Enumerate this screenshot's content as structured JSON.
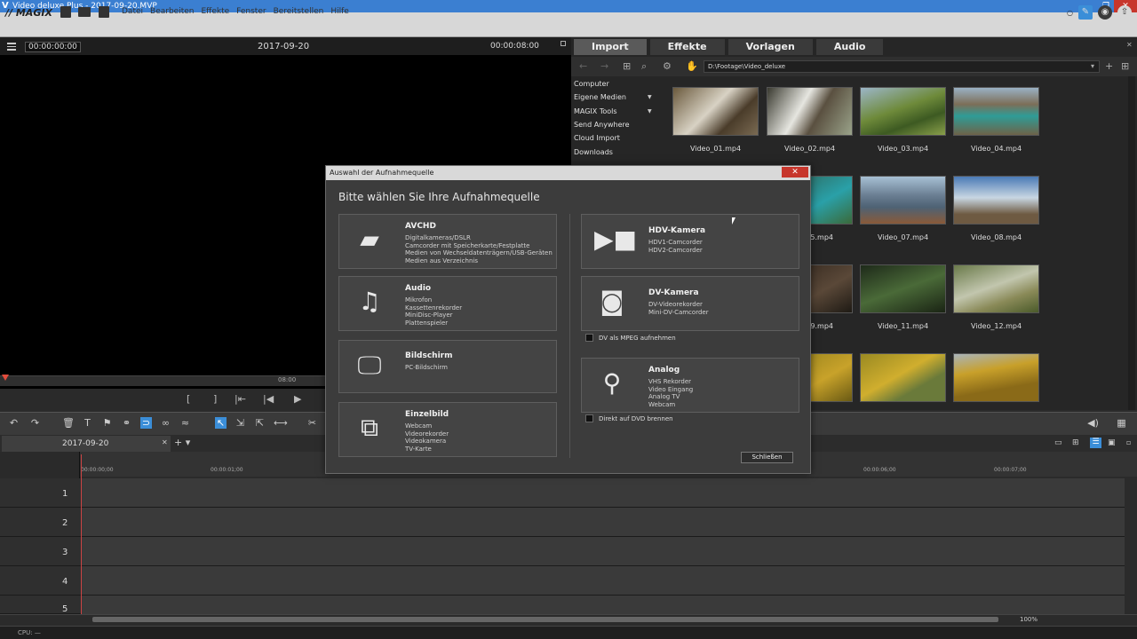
{
  "window": {
    "title": "Video deluxe Plus - 2017-09-20.MVP"
  },
  "menubar": {
    "logo": "// MAGIX",
    "menus": [
      "Datei",
      "Bearbeiten",
      "Effekte",
      "Fenster",
      "Bereitstellen",
      "Hilfe"
    ]
  },
  "monitor": {
    "timecode_left": "00:00:00:00",
    "date": "2017-09-20",
    "timecode_right": "00:00:08:00",
    "ruler_time": "08:00"
  },
  "media": {
    "tabs": [
      "Import",
      "Effekte",
      "Vorlagen",
      "Audio"
    ],
    "path": "D:\\Footage\\Video_deluxe",
    "sidebar": [
      "Computer",
      "Eigene Medien",
      "MAGIX Tools",
      "Send Anywhere",
      "Cloud Import",
      "Downloads"
    ],
    "files": [
      "Video_01.mp4",
      "Video_02.mp4",
      "Video_03.mp4",
      "Video_04.mp4",
      "5.mp4",
      "Video_07.mp4",
      "Video_08.mp4",
      "9.mp4",
      "Video_11.mp4",
      "Video_12.mp4"
    ]
  },
  "project": {
    "tab": "2017-09-20"
  },
  "timeline": {
    "marks": [
      "00:00:00;00",
      "00:00:01;00",
      "00:00:06;00",
      "00:00:07;00"
    ],
    "tracks": [
      "1",
      "2",
      "3",
      "4",
      "5"
    ],
    "zoom": "100%"
  },
  "status": {
    "cpu": "CPU: —"
  },
  "dialog": {
    "title": "Auswahl der Aufnahmequelle",
    "heading": "Bitte wählen Sie Ihre Aufnahmequelle",
    "left": [
      {
        "title": "AVCHD",
        "lines": [
          "Digitalkameras/DSLR",
          "Camcorder mit Speicherkarte/Festplatte",
          "Medien von Wechseldatenträgern/USB-Geräten",
          "Medien aus Verzeichnis"
        ]
      },
      {
        "title": "Audio",
        "lines": [
          "Mikrofon",
          "Kassettenrekorder",
          "MiniDisc-Player",
          "Plattenspieler"
        ]
      },
      {
        "title": "Bildschirm",
        "lines": [
          "PC-Bildschirm"
        ]
      },
      {
        "title": "Einzelbild",
        "lines": [
          "Webcam",
          "Videorekorder",
          "Videokamera",
          "TV-Karte"
        ]
      }
    ],
    "right": [
      {
        "title": "HDV-Kamera",
        "lines": [
          "HDV1-Camcorder",
          "HDV2-Camcorder"
        ]
      },
      {
        "title": "DV-Kamera",
        "lines": [
          "DV-Videorekorder",
          "Mini-DV-Camcorder"
        ]
      },
      {
        "title": "Analog",
        "lines": [
          "VHS Rekorder",
          "Video Eingang",
          "Analog TV",
          "Webcam"
        ]
      }
    ],
    "check_mpeg": "DV als MPEG aufnehmen",
    "check_dvd": "Direkt auf DVD brennen",
    "close_label": "Schließen"
  }
}
